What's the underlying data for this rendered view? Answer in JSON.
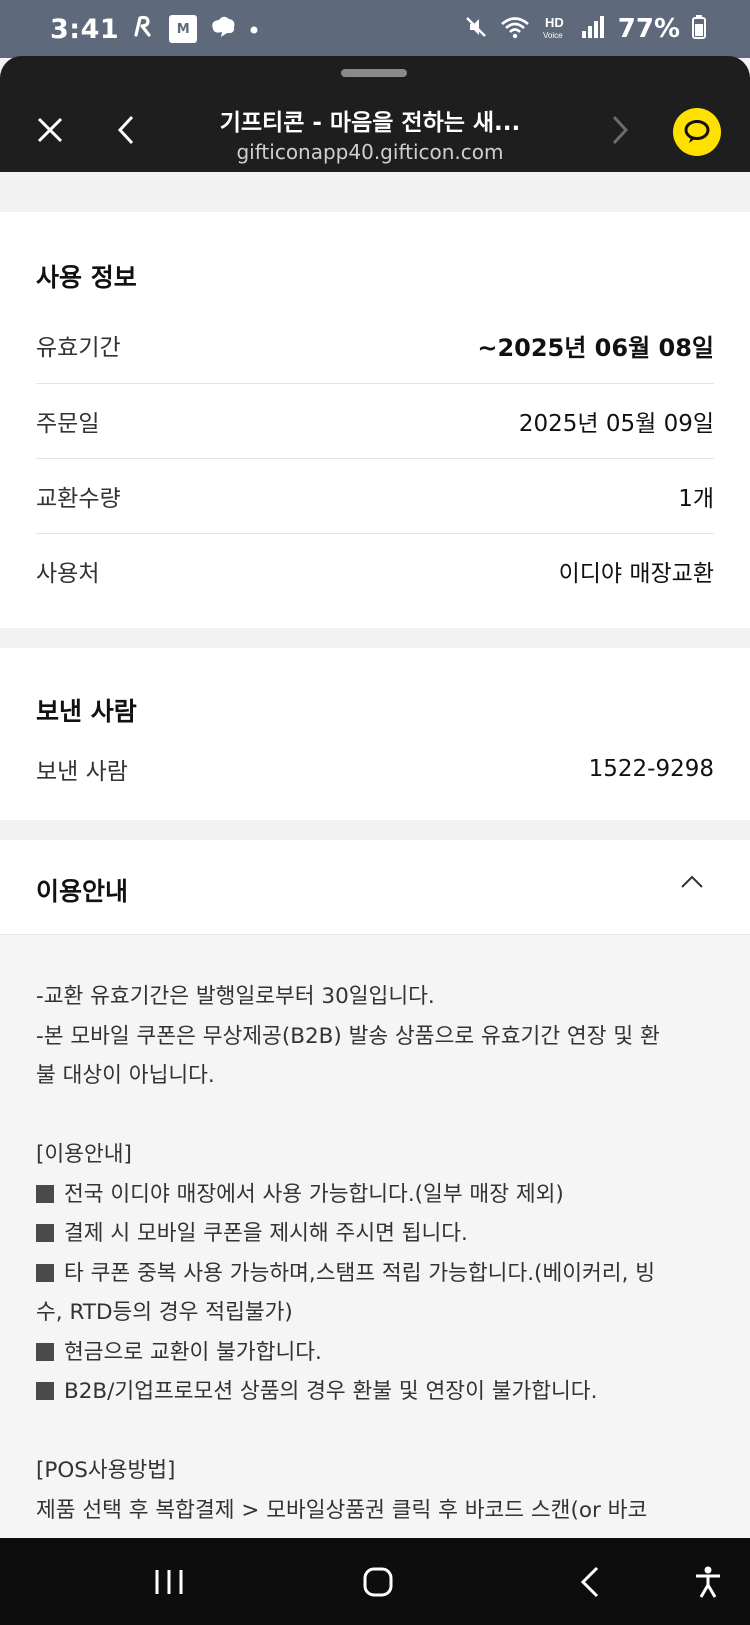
{
  "status_bar": {
    "time": "3:41",
    "icons": [
      "r-app-icon",
      "mstock-icon",
      "chat-cloud-icon",
      "dot-icon"
    ],
    "mstock_label": "M",
    "right_icons": [
      "mute-icon",
      "wifi-icon",
      "hd-voice-icon",
      "signal-icon"
    ],
    "battery": "77%"
  },
  "browser": {
    "title": "기프티콘 - 마음을 전하는 새...",
    "url": "gifticonapp40.gifticon.com",
    "accent_color": "#ffe100"
  },
  "usage_info": {
    "title": "사용 정보",
    "rows": [
      {
        "label": "유효기간",
        "value": "~2025년 06월 08일"
      },
      {
        "label": "주문일",
        "value": "2025년 05월 09일"
      },
      {
        "label": "교환수량",
        "value": "1개"
      },
      {
        "label": "사용처",
        "value": "이디야 매장교환"
      }
    ]
  },
  "sender": {
    "title": "보낸 사람",
    "label": "보낸 사람",
    "value": "1522-9298"
  },
  "guide": {
    "title": "이용안내",
    "lines": [
      "-교환 유효기간은 발행일로부터 30일입니다.",
      "-본 모바일 쿠폰은 무상제공(B2B) 발송 상품으로 유효기간 연장 및 환",
      "불 대상이 아닙니다.",
      "",
      "[이용안내]",
      "전국 이디야 매장에서 사용 가능합니다.(일부 매장 제외)",
      "결제 시 모바일 쿠폰을 제시해 주시면 됩니다.",
      "타 쿠폰 중복 사용 가능하며,스탬프 적립 가능합니다.(베이커리, 빙",
      "수, RTD등의 경우 적립불가)",
      "현금으로 교환이 불가합니다.",
      "B2B/기업프로모션 상품의 경우 환불 및 연장이 불가합니다.",
      "",
      "[POS사용방법]",
      "제품 선택 후 복합결제 > 모바일상품권 클릭 후 바코드 스캔(or 바코"
    ]
  }
}
